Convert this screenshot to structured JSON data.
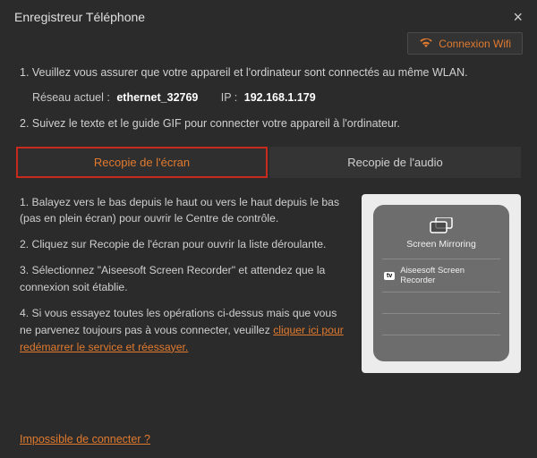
{
  "titlebar": {
    "title": "Enregistreur Téléphone"
  },
  "wifi_button": {
    "label": "Connexion Wifi"
  },
  "intro": {
    "line1": "1. Veuillez vous assurer que votre appareil et l'ordinateur sont connectés au même WLAN.",
    "network_label": "Réseau actuel :",
    "network_value": "ethernet_32769",
    "ip_label": "IP :",
    "ip_value": "192.168.1.179",
    "line2": "2. Suivez le texte et le guide GIF pour connecter votre appareil à l'ordinateur."
  },
  "tabs": {
    "screen": "Recopie de l'écran",
    "audio": "Recopie de l'audio"
  },
  "steps": {
    "s1": "1. Balayez vers le bas depuis le haut ou vers le haut depuis le bas (pas en plein écran) pour ouvrir le Centre de contrôle.",
    "s2": "2. Cliquez sur Recopie de l'écran pour ouvrir la liste déroulante.",
    "s3": "3. Sélectionnez \"Aiseesoft Screen Recorder\" et attendez que la connexion soit établie.",
    "s4_text": "4. Si vous essayez toutes les opérations ci-dessus mais que vous ne parvenez toujours pas à vous connecter, veuillez ",
    "s4_link": "cliquer ici pour redémarrer le service et réessayer."
  },
  "preview": {
    "panel_title": "Screen Mirroring",
    "device": "Aiseesoft Screen Recorder"
  },
  "footer": {
    "cannot_connect": "Impossible de connecter ?"
  },
  "colors": {
    "accent": "#e07a2f",
    "bg": "#2b2b2b"
  }
}
